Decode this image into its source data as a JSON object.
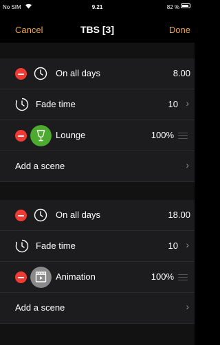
{
  "status_bar": {
    "carrier": "No SIM",
    "time": "9.21",
    "battery": "82 %"
  },
  "nav": {
    "cancel_label": "Cancel",
    "title": "TBS [3]",
    "done_label": "Done"
  },
  "groups": [
    {
      "schedule_label": "On all days",
      "schedule_time": "8.00",
      "fade_label": "Fade time",
      "fade_value": "10",
      "scene_name": "Lounge",
      "scene_level": "100%",
      "add_scene_label": "Add a scene"
    },
    {
      "schedule_label": "On all days",
      "schedule_time": "18.00",
      "fade_label": "Fade time",
      "fade_value": "10",
      "scene_name": "Animation",
      "scene_level": "100%",
      "add_scene_label": "Add a scene"
    }
  ],
  "colors": {
    "accent": "#f0a44a",
    "delete_red": "#ef3b34",
    "lounge_icon_bg": "#4caa2e",
    "animation_icon_bg": "#8a8a8a",
    "row_bg": "#1c1c1e",
    "gap_bg": "#121212"
  },
  "icons": {
    "clock": "clock-icon",
    "fade": "fade-time-icon",
    "lounge": "wine-glass-icon",
    "animation": "film-clapper-icon",
    "chevron": "chevron-right-icon",
    "drag": "drag-handle-icon"
  }
}
